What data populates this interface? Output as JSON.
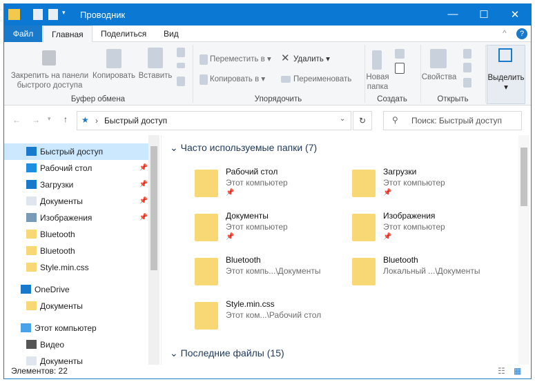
{
  "window": {
    "title": "Проводник",
    "minimize": "—",
    "maximize": "☐",
    "close": "✕"
  },
  "tabs": {
    "file": "Файл",
    "home": "Главная",
    "share": "Поделиться",
    "view": "Вид",
    "collapse": "^",
    "help": "?"
  },
  "ribbon": {
    "pin": "Закрепить на панели быстрого доступа",
    "copy": "Копировать",
    "paste": "Вставить",
    "clipboard": "Буфер обмена",
    "move_to": "Переместить в",
    "copy_to": "Копировать в",
    "delete": "Удалить",
    "rename": "Переименовать",
    "organize": "Упорядочить",
    "new_folder": "Новая папка",
    "create": "Создать",
    "properties": "Свойства",
    "open": "Открыть",
    "select": "Выделить"
  },
  "address": {
    "path": "Быстрый доступ",
    "search_placeholder": "Поиск: Быстрый доступ"
  },
  "nav": {
    "items": [
      {
        "label": "Быстрый доступ",
        "icon": "star-icon",
        "pinned": false,
        "selected": true
      },
      {
        "label": "Рабочий стол",
        "icon": "desktop-icon",
        "pinned": true
      },
      {
        "label": "Загрузки",
        "icon": "download-icon",
        "pinned": true
      },
      {
        "label": "Документы",
        "icon": "documents-icon",
        "pinned": true
      },
      {
        "label": "Изображения",
        "icon": "pictures-icon",
        "pinned": true
      },
      {
        "label": "Bluetooth",
        "icon": "folder-icon",
        "pinned": false
      },
      {
        "label": "Bluetooth",
        "icon": "folder-icon",
        "pinned": false
      },
      {
        "label": "Style.min.css",
        "icon": "folder-icon",
        "pinned": false
      },
      {
        "label": "OneDrive",
        "icon": "cloud-icon",
        "pinned": false
      },
      {
        "label": "Документы",
        "icon": "folder-icon",
        "pinned": false
      },
      {
        "label": "Этот компьютер",
        "icon": "computer-icon",
        "pinned": false
      },
      {
        "label": "Видео",
        "icon": "video-icon",
        "pinned": false
      },
      {
        "label": "Документы",
        "icon": "documents-icon",
        "pinned": false
      }
    ]
  },
  "main": {
    "frequent": "Часто используемые папки (7)",
    "recent": "Последние файлы (15)",
    "folders": [
      {
        "name": "Рабочий стол",
        "sub": "Этот компьютер",
        "pinned": true
      },
      {
        "name": "Загрузки",
        "sub": "Этот компьютер",
        "pinned": true
      },
      {
        "name": "Документы",
        "sub": "Этот компьютер",
        "pinned": true
      },
      {
        "name": "Изображения",
        "sub": "Этот компьютер",
        "pinned": true
      },
      {
        "name": "Bluetooth",
        "sub": "Этот компь...\\Документы",
        "pinned": false
      },
      {
        "name": "Bluetooth",
        "sub": "Локальный ...\\Документы",
        "pinned": false
      },
      {
        "name": "Style.min.css",
        "sub": "Этот ком...\\Рабочий стол",
        "pinned": false
      }
    ]
  },
  "status": {
    "count": "Элементов: 22"
  },
  "colors": {
    "accent": "#0b78d4",
    "folder": "#f8d775"
  }
}
